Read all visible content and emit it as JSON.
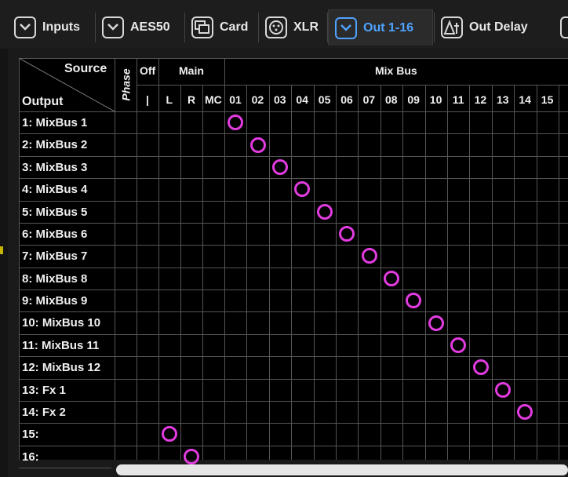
{
  "tabs": [
    {
      "id": "inputs",
      "label": "Inputs",
      "icon": "in-arrow-icon",
      "icon_text": "IN",
      "active": false
    },
    {
      "id": "aes50",
      "label": "AES50",
      "icon": "out-arrow-icon",
      "icon_text": "OUT",
      "active": false
    },
    {
      "id": "card",
      "label": "Card",
      "icon": "card-icon",
      "icon_text": "",
      "active": false
    },
    {
      "id": "xlr",
      "label": "XLR",
      "icon": "xlr-connector-icon",
      "icon_text": "",
      "active": false
    },
    {
      "id": "out116",
      "label": "Out 1-16",
      "icon": "out-arrow-icon",
      "icon_text": "OUT",
      "active": true
    },
    {
      "id": "outdelay",
      "label": "Out Delay",
      "icon": "delta-t-icon",
      "icon_text": "",
      "active": false
    }
  ],
  "matrix": {
    "corner_source": "Source",
    "corner_output": "Output",
    "phase_label": "Phase",
    "off_label": "Off",
    "off_sub": "|",
    "main_label": "Main",
    "main_columns": [
      "L",
      "R",
      "MC"
    ],
    "mixbus_label": "Mix Bus",
    "mixbus_columns": [
      "01",
      "02",
      "03",
      "04",
      "05",
      "06",
      "07",
      "08",
      "09",
      "10",
      "11",
      "12",
      "13",
      "14",
      "15"
    ],
    "rows": [
      {
        "label": "1: MixBus 1",
        "assigned": "01"
      },
      {
        "label": "2: MixBus 2",
        "assigned": "02"
      },
      {
        "label": "3: MixBus 3",
        "assigned": "03"
      },
      {
        "label": "4: MixBus 4",
        "assigned": "04"
      },
      {
        "label": "5: MixBus 5",
        "assigned": "05"
      },
      {
        "label": "6: MixBus 6",
        "assigned": "06"
      },
      {
        "label": "7: MixBus 7",
        "assigned": "07"
      },
      {
        "label": "8: MixBus 8",
        "assigned": "08"
      },
      {
        "label": "9: MixBus 9",
        "assigned": "09"
      },
      {
        "label": "10: MixBus 10",
        "assigned": "10"
      },
      {
        "label": "11: MixBus 11",
        "assigned": "11"
      },
      {
        "label": "12: MixBus 12",
        "assigned": "12"
      },
      {
        "label": "13: Fx 1",
        "assigned": "13"
      },
      {
        "label": "14: Fx 2",
        "assigned": "14"
      },
      {
        "label": "15:",
        "assigned": "L"
      },
      {
        "label": "16:",
        "assigned": "R"
      }
    ]
  },
  "colors": {
    "active_tab": "#4fa3ff",
    "marker": "#e23be0",
    "grid_line": "#555555",
    "background": "#000000"
  }
}
